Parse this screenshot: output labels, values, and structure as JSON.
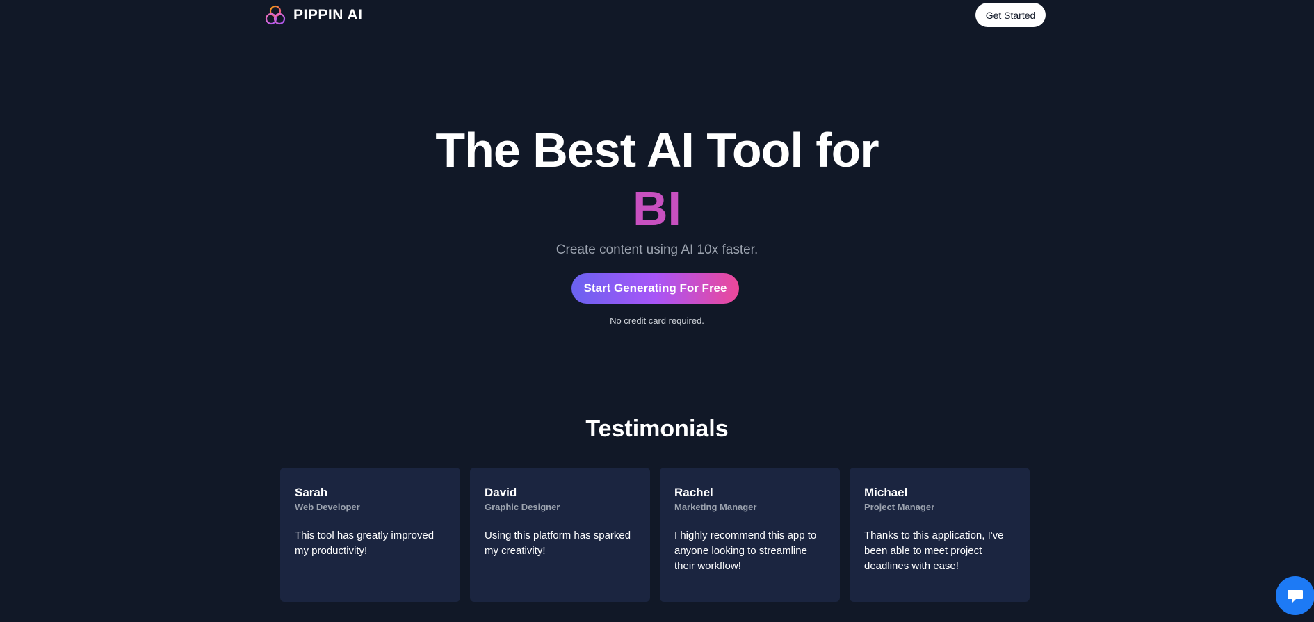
{
  "header": {
    "brand_name": "PIPPIN AI",
    "logo_icon": "three-circles-logo-icon",
    "get_started_label": "Get Started"
  },
  "hero": {
    "title": "The Best AI Tool for",
    "highlight": "BI",
    "subtitle": "Create content using AI 10x faster.",
    "cta_label": "Start Generating For Free",
    "cta_note": "No credit card required."
  },
  "testimonials": {
    "heading": "Testimonials",
    "items": [
      {
        "name": "Sarah",
        "role": "Web Developer",
        "quote": "This tool has greatly improved my productivity!"
      },
      {
        "name": "David",
        "role": "Graphic Designer",
        "quote": "Using this platform has sparked my creativity!"
      },
      {
        "name": "Rachel",
        "role": "Marketing Manager",
        "quote": "I highly recommend this app to anyone looking to streamline their workflow!"
      },
      {
        "name": "Michael",
        "role": "Project Manager",
        "quote": "Thanks to this application, I've been able to meet project deadlines with ease!"
      }
    ]
  },
  "chat": {
    "icon": "chat-bubble-icon"
  },
  "colors": {
    "background": "#111827",
    "card": "#1b2540",
    "highlight": "#c850c0",
    "cta_gradient_start": "#6a62f0",
    "cta_gradient_end": "#ec4899",
    "chat": "#1d7af5"
  }
}
